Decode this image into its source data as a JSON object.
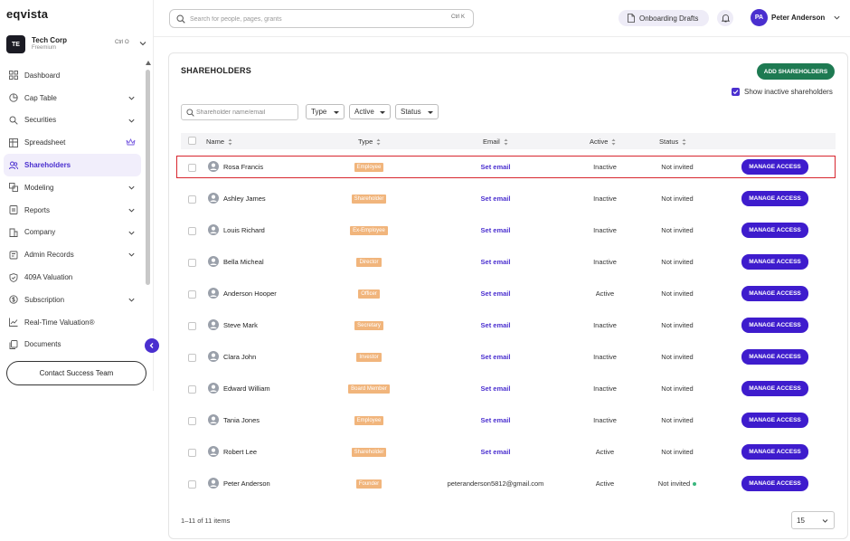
{
  "app": {
    "logo": "eqvista"
  },
  "org": {
    "badge": "TE",
    "name": "Tech Corp",
    "plan": "Freemium",
    "shortcut": "Ctrl O"
  },
  "sidebar": {
    "items": [
      {
        "label": "Dashboard",
        "icon": "dashboard-icon",
        "chevron": false
      },
      {
        "label": "Cap Table",
        "icon": "pie-chart-icon",
        "chevron": true
      },
      {
        "label": "Securities",
        "icon": "securities-icon",
        "chevron": true
      },
      {
        "label": "Spreadsheet",
        "icon": "spreadsheet-icon",
        "chevron": false,
        "crown": true
      },
      {
        "label": "Shareholders",
        "icon": "users-icon",
        "chevron": false,
        "active": true
      },
      {
        "label": "Modeling",
        "icon": "modeling-icon",
        "chevron": true
      },
      {
        "label": "Reports",
        "icon": "reports-icon",
        "chevron": true
      },
      {
        "label": "Company",
        "icon": "company-icon",
        "chevron": true
      },
      {
        "label": "Admin Records",
        "icon": "admin-records-icon",
        "chevron": true
      },
      {
        "label": "409A Valuation",
        "icon": "shield-icon",
        "chevron": false
      },
      {
        "label": "Subscription",
        "icon": "subscription-icon",
        "chevron": true
      },
      {
        "label": "Real-Time Valuation®",
        "icon": "trend-chart-icon",
        "chevron": false
      },
      {
        "label": "Documents",
        "icon": "documents-icon",
        "chevron": false
      }
    ],
    "contact_label": "Contact Success Team"
  },
  "topbar": {
    "search_placeholder": "Search for people, pages, grants",
    "search_shortcut": "Ctrl K",
    "drafts_label": "Onboarding Drafts",
    "user_initials": "PA",
    "user_name": "Peter Anderson"
  },
  "card": {
    "title": "SHAREHOLDERS",
    "add_label": "ADD SHAREHOLDERS",
    "show_inactive_label": "Show inactive shareholders",
    "show_inactive_checked": true,
    "filter_placeholder": "Shareholder name/email",
    "filters": {
      "type": "Type",
      "active": "Active",
      "status": "Status"
    },
    "columns": {
      "name": "Name",
      "type": "Type",
      "email": "Email",
      "active": "Active",
      "status": "Status"
    },
    "manage_label": "MANAGE ACCESS",
    "rows": [
      {
        "name": "Rosa Francis",
        "type": "Employee",
        "email": "Set email",
        "email_is_link": true,
        "active": "Inactive",
        "status": "Not invited",
        "dot": false
      },
      {
        "name": "Ashley James",
        "type": "Shareholder",
        "email": "Set email",
        "email_is_link": true,
        "active": "Inactive",
        "status": "Not invited",
        "dot": false
      },
      {
        "name": "Louis Richard",
        "type": "Ex-Employee",
        "email": "Set email",
        "email_is_link": true,
        "active": "Inactive",
        "status": "Not invited",
        "dot": false
      },
      {
        "name": "Bella Micheal",
        "type": "Director",
        "email": "Set email",
        "email_is_link": true,
        "active": "Inactive",
        "status": "Not invited",
        "dot": false
      },
      {
        "name": "Anderson Hooper",
        "type": "Officer",
        "email": "Set email",
        "email_is_link": true,
        "active": "Active",
        "status": "Not invited",
        "dot": false
      },
      {
        "name": "Steve Mark",
        "type": "Secretary",
        "email": "Set email",
        "email_is_link": true,
        "active": "Inactive",
        "status": "Not invited",
        "dot": false
      },
      {
        "name": "Clara John",
        "type": "Investor",
        "email": "Set email",
        "email_is_link": true,
        "active": "Inactive",
        "status": "Not invited",
        "dot": false
      },
      {
        "name": "Edward William",
        "type": "Board Member",
        "email": "Set email",
        "email_is_link": true,
        "active": "Inactive",
        "status": "Not invited",
        "dot": false
      },
      {
        "name": "Tania Jones",
        "type": "Employee",
        "email": "Set email",
        "email_is_link": true,
        "active": "Inactive",
        "status": "Not invited",
        "dot": false
      },
      {
        "name": "Robert Lee",
        "type": "Shareholder",
        "email": "Set email",
        "email_is_link": true,
        "active": "Active",
        "status": "Not invited",
        "dot": false
      },
      {
        "name": "Peter Anderson",
        "type": "Founder",
        "email": "peteranderson5812@gmail.com",
        "email_is_link": false,
        "active": "Active",
        "status": "Not invited",
        "dot": true
      }
    ],
    "pager_text": "1–11 of 11 items",
    "page_size": "15"
  },
  "colors": {
    "brand": "#4a2fcf",
    "manage_button": "#3e1ccd",
    "add_button": "#1e7a52",
    "type_tag": "#f1b57c",
    "highlight_border": "#d8262e",
    "status_dot": "#3bb77e"
  }
}
